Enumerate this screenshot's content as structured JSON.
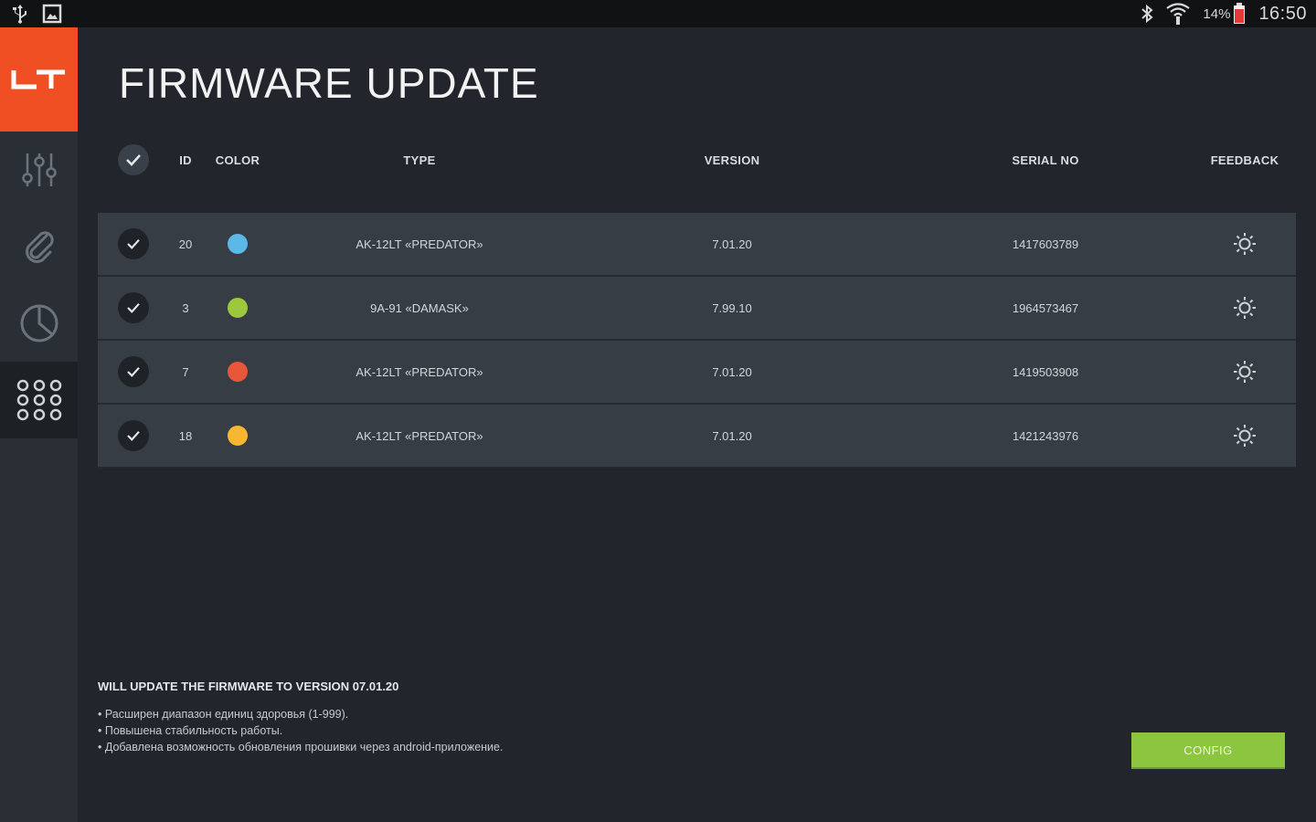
{
  "status_bar": {
    "left_icons": [
      "usb-icon",
      "image-icon"
    ],
    "right_icons": [
      "bluetooth-icon",
      "wifi-icon",
      "battery-icon"
    ],
    "battery": "14%",
    "time": "16:50",
    "battery_color": "#e53935"
  },
  "sidebar": {
    "logo_text": "LT",
    "logo_color": "#f04e23",
    "items": [
      {
        "icon": "sliders-icon",
        "active": false
      },
      {
        "icon": "paperclip-icon",
        "active": false
      },
      {
        "icon": "pie-chart-icon",
        "active": false
      },
      {
        "icon": "grid-dots-icon",
        "active": true
      }
    ]
  },
  "page": {
    "title": "FIRMWARE UPDATE"
  },
  "table": {
    "headers": {
      "id": "ID",
      "color": "COLOR",
      "type": "TYPE",
      "version": "VERSION",
      "serial": "SERIAL NO",
      "feedback": "FEEDBACK"
    },
    "rows": [
      {
        "checked": true,
        "id": "20",
        "color": "#5bb8e8",
        "type": "AK-12LT «PREDATOR»",
        "version": "7.01.20",
        "serial": "1417603789"
      },
      {
        "checked": true,
        "id": "3",
        "color": "#9dc83b",
        "type": "9A-91 «DAMASK»",
        "version": "7.99.10",
        "serial": "1964573467"
      },
      {
        "checked": true,
        "id": "7",
        "color": "#e8573a",
        "type": "AK-12LT «PREDATOR»",
        "version": "7.01.20",
        "serial": "1419503908"
      },
      {
        "checked": true,
        "id": "18",
        "color": "#f7b731",
        "type": "AK-12LT «PREDATOR»",
        "version": "7.01.20",
        "serial": "1421243976"
      }
    ]
  },
  "notes": {
    "title": "WILL UPDATE THE FIRMWARE TO VERSION 07.01.20",
    "items": [
      "Расширен диапазон единиц здоровья (1-999).",
      "Повышена стабильность работы.",
      "Добавлена возможность обновления прошивки через android-приложение."
    ]
  },
  "config_button": {
    "label": "CONFIG",
    "color": "#8cc63f"
  }
}
